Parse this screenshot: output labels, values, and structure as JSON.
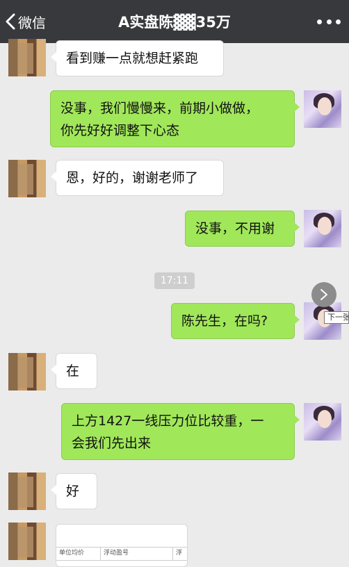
{
  "header": {
    "back_label": "微信",
    "title": "A实盘陈▓▓35万"
  },
  "messages": [
    {
      "side": "in",
      "lines": [
        "看到赚一点就想赶紧跑"
      ]
    },
    {
      "side": "out",
      "lines": [
        "没事，我们慢慢来，前期小做做，",
        "你先好好调整下心态"
      ]
    },
    {
      "side": "in",
      "lines": [
        "恩，好的，谢谢老师了"
      ]
    },
    {
      "side": "out",
      "lines": [
        "没事，不用谢"
      ]
    },
    {
      "side": "out",
      "lines": [
        "陈先生，在吗?"
      ]
    },
    {
      "side": "in",
      "lines": [
        "在"
      ]
    },
    {
      "side": "out",
      "lines": [
        "上方1427一线压力位比较重，一",
        "会我们先出来"
      ]
    },
    {
      "side": "in",
      "lines": [
        "好"
      ]
    }
  ],
  "timestamp": "17:11",
  "tooltip": "下一张",
  "doc_preview": {
    "columns": [
      "单位均价",
      "浮动盈号",
      "浮"
    ]
  },
  "colors": {
    "header_bg": "#38393d",
    "chat_bg": "#ebebeb",
    "outgoing_bubble": "#a0e75a",
    "incoming_bubble": "#ffffff"
  }
}
